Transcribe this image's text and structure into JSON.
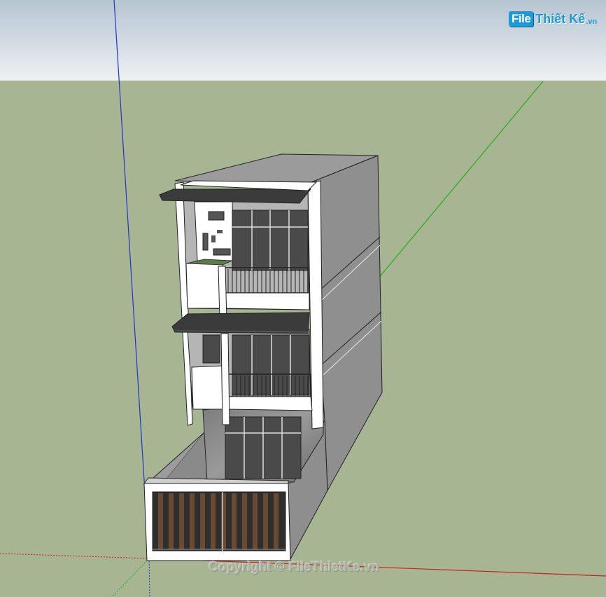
{
  "logo": {
    "file_text": "File",
    "name_text": "Thiết Kế",
    "tld_text": ".vn"
  },
  "watermark": {
    "text": "Copyright © FileThietKe.vn"
  },
  "colors": {
    "sky_top": "#b9c7d3",
    "sky_bottom": "#eef1f4",
    "ground": "#a7b593",
    "wall_gray": "#8f8f8f",
    "wall_light": "#a4a4a4",
    "roof_top": "#9b9b9b",
    "white_frame": "#ffffff",
    "canopy_dark": "#3b3b3b",
    "glass_dark": "#4a4a4a",
    "wood_slat": "#6b4a33",
    "axis_blue": "#1f35c8",
    "axis_green": "#1fb01f",
    "axis_red": "#c81f1f",
    "logo_blue": "#1e9bd7"
  }
}
